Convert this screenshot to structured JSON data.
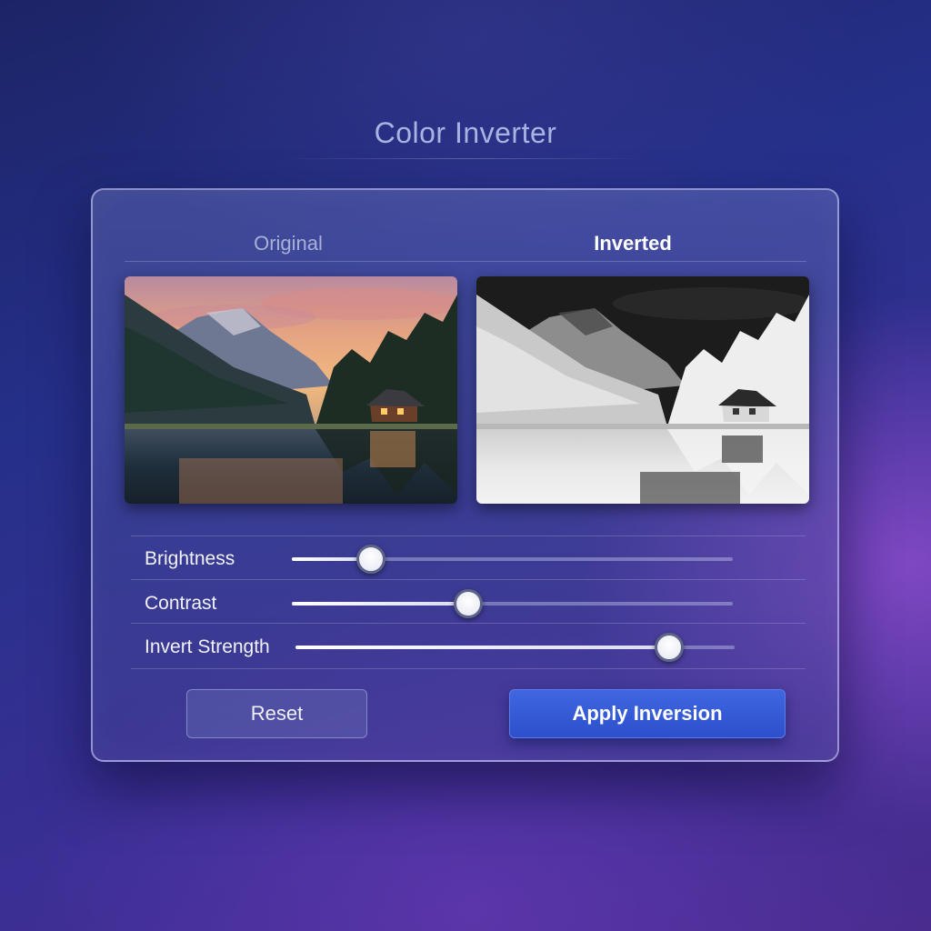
{
  "app": {
    "title": "Color Inverter"
  },
  "tabs": {
    "original_label": "Original",
    "inverted_label": "Inverted",
    "active": "Inverted"
  },
  "images": {
    "original": {
      "subject": "mountain lake with cabin at sunset"
    },
    "inverted": {
      "subject": "color-inverted mountain lake with cabin"
    }
  },
  "sliders": [
    {
      "label": "Brightness",
      "value": 0.18
    },
    {
      "label": "Contrast",
      "value": 0.4
    },
    {
      "label": "Invert Strength",
      "value": 0.85
    }
  ],
  "buttons": {
    "reset_label": "Reset",
    "apply_label": "Apply Inversion"
  },
  "colors": {
    "accent": "#3456d6",
    "panel_border": "#d7dcff",
    "text_primary": "#f1f2fb",
    "text_muted": "#a9b0d8"
  }
}
